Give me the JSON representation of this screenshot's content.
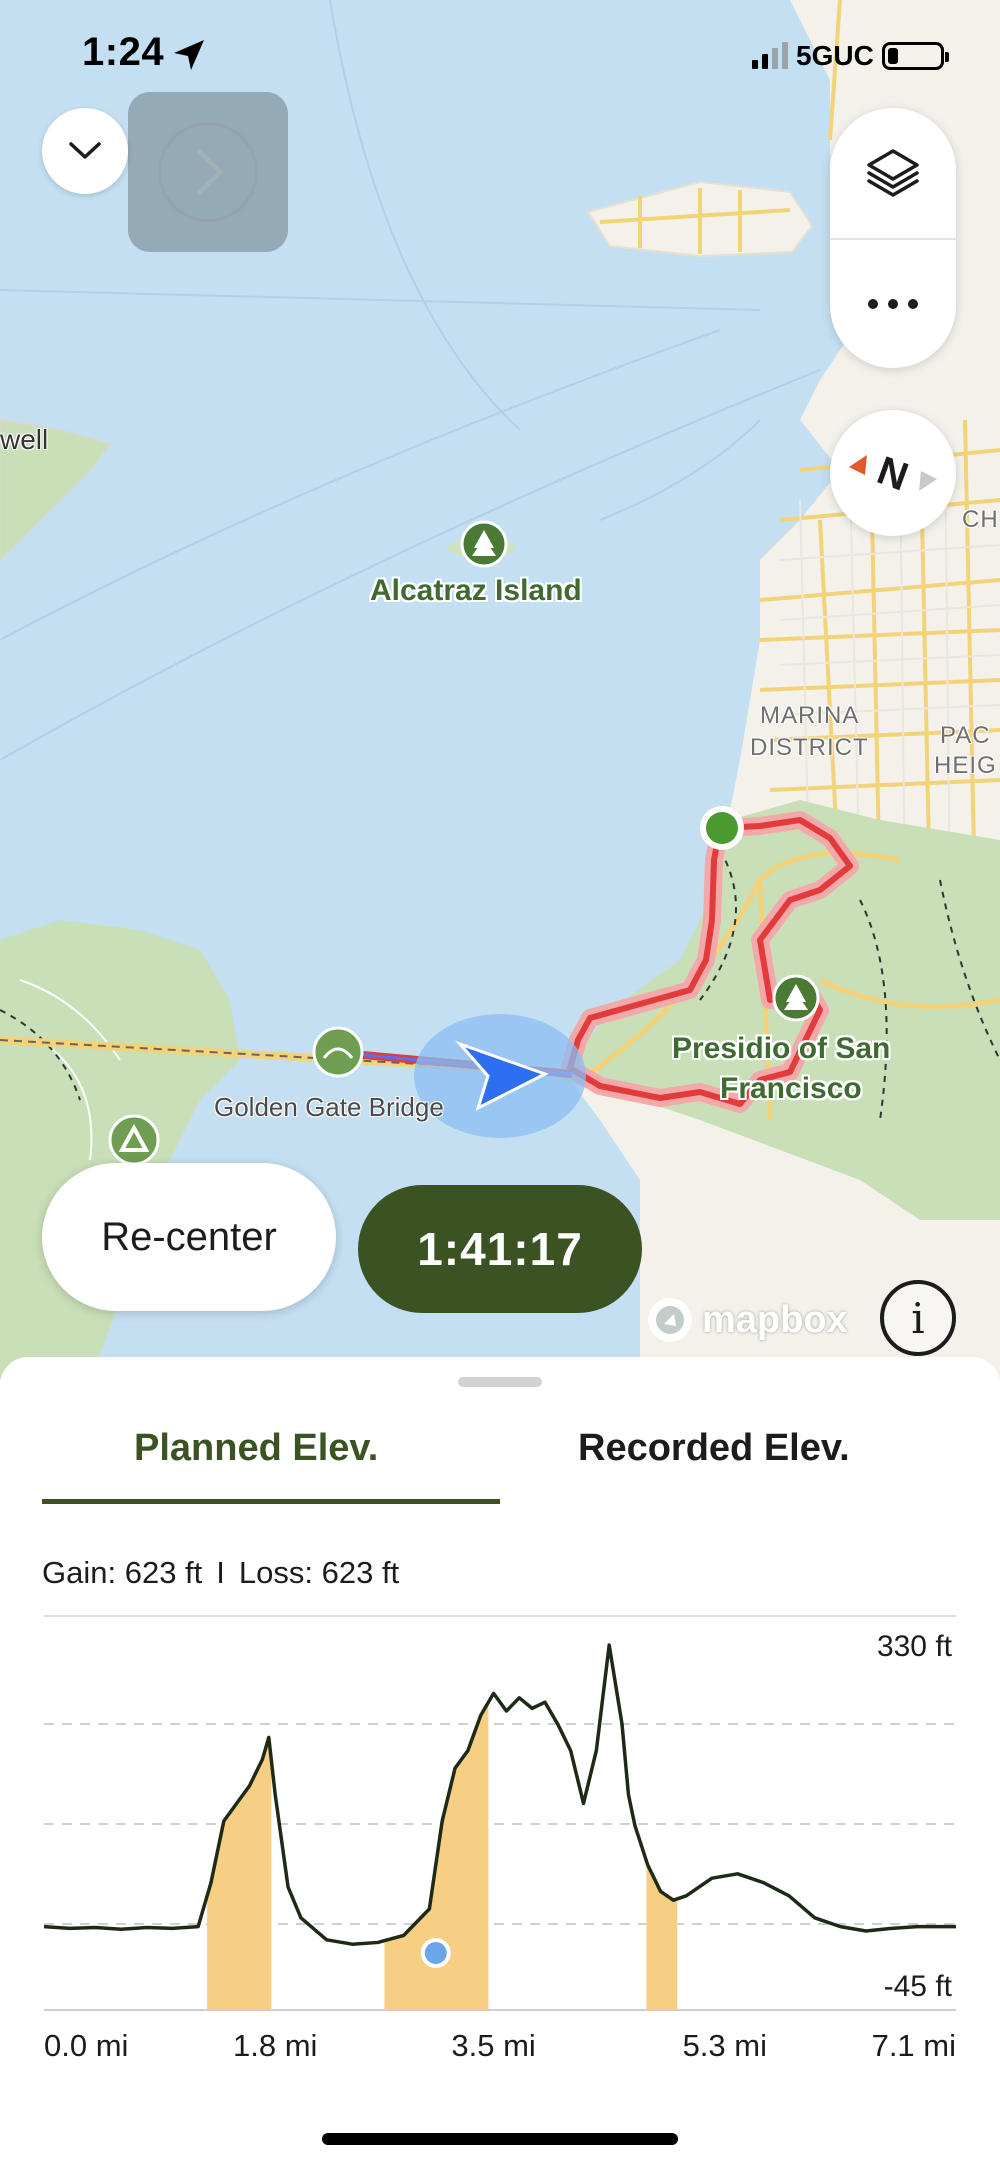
{
  "status_bar": {
    "time": "1:24",
    "network": "5GUC"
  },
  "map": {
    "labels": {
      "alcatraz": "Alcatraz Island",
      "golden_gate": "Golden Gate Bridge",
      "presidio_line1": "Presidio of San",
      "presidio_line2": "Francisco",
      "marina_line1": "MARINA",
      "marina_line2": "DISTRICT",
      "pac_line1": "PAC",
      "pac_line2": "HEIG",
      "ch": "CH",
      "well": "well"
    },
    "compass_letter": "N",
    "attribution": "mapbox",
    "info_glyph": "i",
    "colors": {
      "water": "#c4dff1",
      "land": "#f3f1ea",
      "park": "#c9dfb8",
      "route": "#e23b3b",
      "road": "#f5d25e",
      "position": "#2d6ff0"
    }
  },
  "controls": {
    "recenter_label": "Re-center",
    "timer": "1:41:17"
  },
  "sheet": {
    "tabs": [
      {
        "label": "Planned Elev.",
        "active": true
      },
      {
        "label": "Recorded Elev.",
        "active": false
      }
    ],
    "stats": {
      "gain": "Gain: 623 ft",
      "separator": "I",
      "loss": "Loss: 623 ft"
    }
  },
  "chart_data": {
    "type": "area",
    "x_unit": "mi",
    "y_unit": "ft",
    "xlim": [
      0,
      7.1
    ],
    "ylim": [
      -45,
      330
    ],
    "x_tick_labels": [
      "0.0 mi",
      "1.8 mi",
      "3.5 mi",
      "5.3 mi",
      "7.1 mi"
    ],
    "y_tick_labels": [
      "330 ft",
      "-45 ft"
    ],
    "series": [
      {
        "x": [
          0,
          0.2,
          0.4,
          0.6,
          0.8,
          1.0,
          1.2,
          1.3,
          1.4,
          1.5,
          1.6,
          1.7,
          1.75,
          1.8,
          1.9,
          2.0,
          2.2,
          2.4,
          2.6,
          2.8,
          3.0,
          3.1,
          3.2,
          3.25,
          3.3,
          3.4,
          3.5,
          3.6,
          3.7,
          3.8,
          3.9,
          4.0,
          4.1,
          4.2,
          4.3,
          4.4,
          4.5,
          4.55,
          4.6,
          4.7,
          4.8,
          4.9,
          5.0,
          5.2,
          5.4,
          5.6,
          5.8,
          6.0,
          6.2,
          6.4,
          6.6,
          6.8,
          7.0,
          7.1
        ],
        "y": [
          10,
          8,
          9,
          7,
          9,
          8,
          10,
          60,
          130,
          150,
          170,
          200,
          225,
          160,
          55,
          20,
          -5,
          -10,
          -8,
          0,
          30,
          130,
          190,
          200,
          210,
          250,
          275,
          255,
          270,
          258,
          265,
          240,
          210,
          150,
          210,
          330,
          240,
          160,
          125,
          80,
          50,
          40,
          45,
          65,
          70,
          60,
          45,
          20,
          10,
          5,
          8,
          10,
          10,
          10
        ]
      }
    ],
    "highlighted_x_ranges": [
      [
        1.27,
        1.77
      ],
      [
        2.65,
        3.46
      ],
      [
        4.69,
        4.93
      ]
    ],
    "current_position": {
      "x": 3.05,
      "y": -20
    },
    "grid": "dashed horizontal"
  }
}
